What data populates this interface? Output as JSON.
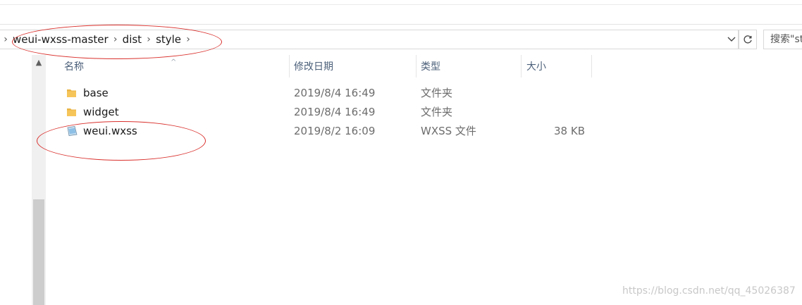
{
  "breadcrumb": {
    "items": [
      "weui-wxss-master",
      "dist",
      "style"
    ]
  },
  "search": {
    "text": "搜索\"style\""
  },
  "columns": {
    "name": "名称",
    "date_modified": "修改日期",
    "type": "类型",
    "size": "大小"
  },
  "files": [
    {
      "name": "base",
      "date": "2019/8/4 16:49",
      "type": "文件夹",
      "size": "",
      "icon": "folder-icon"
    },
    {
      "name": "widget",
      "date": "2019/8/4 16:49",
      "type": "文件夹",
      "size": "",
      "icon": "folder-icon"
    },
    {
      "name": "weui.wxss",
      "date": "2019/8/2 16:09",
      "type": "WXSS 文件",
      "size": "38 KB",
      "icon": "wxss-file-icon"
    }
  ],
  "watermark": "https://blog.csdn.net/qq_45026387",
  "colors": {
    "annotation": "#d9302c",
    "folder": "#f6c55a",
    "header_text": "#4c607a"
  }
}
